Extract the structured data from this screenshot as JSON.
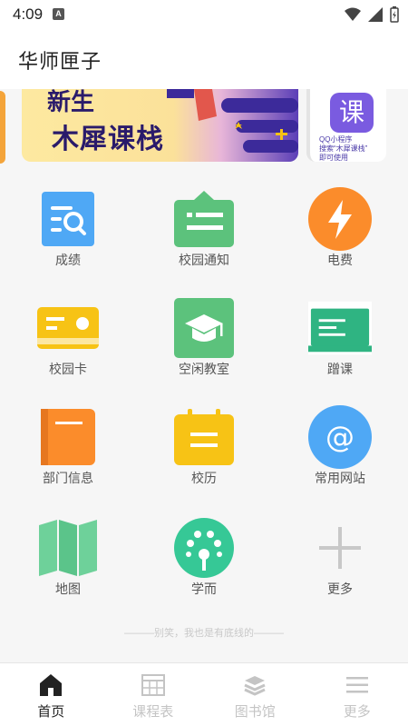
{
  "status_bar": {
    "time": "4:09",
    "notif_letter": "A"
  },
  "app_bar": {
    "title": "华师匣子"
  },
  "banner": {
    "headline_top": "新生",
    "headline": "木犀课栈",
    "side_icon_text": "课",
    "side_lines": [
      "QQ小程序",
      "搜索“木犀课栈”",
      "即可使用"
    ]
  },
  "grid": [
    {
      "label": "成绩",
      "icon": "grades-search-icon",
      "color": "#4fa8f5"
    },
    {
      "label": "校园通知",
      "icon": "notice-board-icon",
      "color": "#5cc27c"
    },
    {
      "label": "电费",
      "icon": "lightning-icon",
      "color": "#fb8c2b"
    },
    {
      "label": "校园卡",
      "icon": "campus-card-icon",
      "color": "#f7c315"
    },
    {
      "label": "空闲教室",
      "icon": "graduation-cap-icon",
      "color": "#5cc27c"
    },
    {
      "label": "蹭课",
      "icon": "blackboard-icon",
      "color": "#2fb482"
    },
    {
      "label": "部门信息",
      "icon": "department-book-icon",
      "color": "#fb8c2b"
    },
    {
      "label": "校历",
      "icon": "calendar-icon",
      "color": "#f7c315"
    },
    {
      "label": "常用网站",
      "icon": "at-sign-icon",
      "color": "#4fa8f5"
    },
    {
      "label": "地图",
      "icon": "map-icon",
      "color": "#6ed19a"
    },
    {
      "label": "学而",
      "icon": "xueer-logo-icon",
      "color": "#36c896"
    },
    {
      "label": "更多",
      "icon": "plus-icon",
      "color": "#c8c8c8"
    }
  ],
  "footer_note": "———别笑，我也是有底线的———",
  "bottom_nav": [
    {
      "label": "首页",
      "icon": "home-icon",
      "active": true
    },
    {
      "label": "课程表",
      "icon": "timetable-icon",
      "active": false
    },
    {
      "label": "图书馆",
      "icon": "library-books-icon",
      "active": false
    },
    {
      "label": "更多",
      "icon": "menu-icon",
      "active": false
    }
  ]
}
